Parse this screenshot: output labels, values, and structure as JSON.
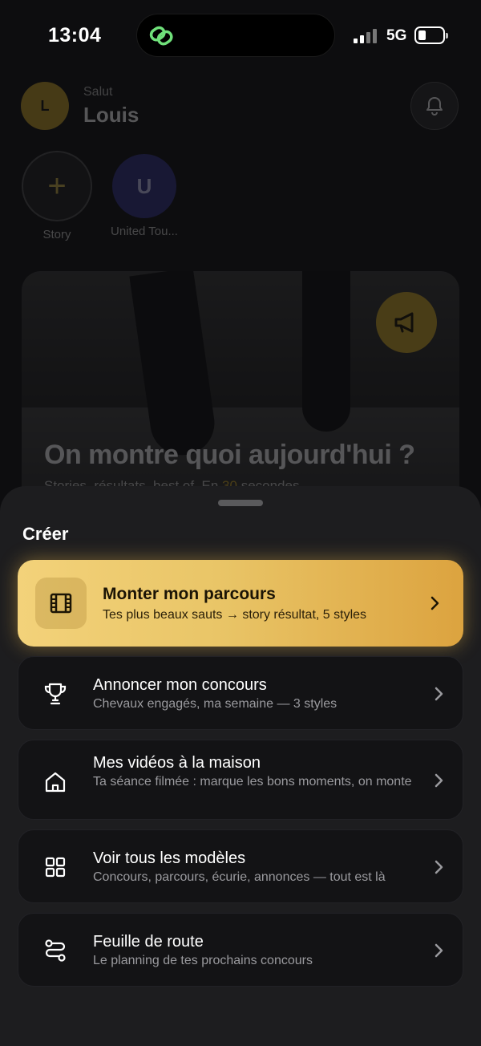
{
  "status": {
    "time": "13:04",
    "network": "5G"
  },
  "home": {
    "greeting": "Salut",
    "user_name": "Louis",
    "avatar_initial": "L",
    "stories": [
      {
        "initial": "+",
        "label": "Story"
      },
      {
        "initial": "U",
        "label": "United Tou..."
      }
    ],
    "hero": {
      "title": "On montre quoi aujourd'hui ?",
      "subtitle_start": "Stories, résultats, best of. En ",
      "subtitle_highlight": "30",
      "subtitle_end": " secondes."
    }
  },
  "sheet": {
    "title": "Créer",
    "items": [
      {
        "icon": "film-icon",
        "title": "Monter mon parcours",
        "subtitle": "Tes plus beaux sauts → story résultat, 5 styles"
      },
      {
        "icon": "trophy-icon",
        "title": "Annoncer mon concours",
        "subtitle": "Chevaux engagés, ma semaine — 3 styles"
      },
      {
        "icon": "home-icon",
        "title": "Mes vidéos à la maison",
        "subtitle": "Ta séance filmée : marque les bons moments, on monte"
      },
      {
        "icon": "grid-icon",
        "title": "Voir tous les modèles",
        "subtitle": "Concours, parcours, écurie, annonces — tout est là"
      },
      {
        "icon": "route-icon",
        "title": "Feuille de route",
        "subtitle": "Le planning de tes prochains concours"
      }
    ]
  },
  "colors": {
    "accent_gold": "#d4ac2b",
    "sheet_bg": "#1d1d1f",
    "island_icon": "#6fe07a"
  }
}
